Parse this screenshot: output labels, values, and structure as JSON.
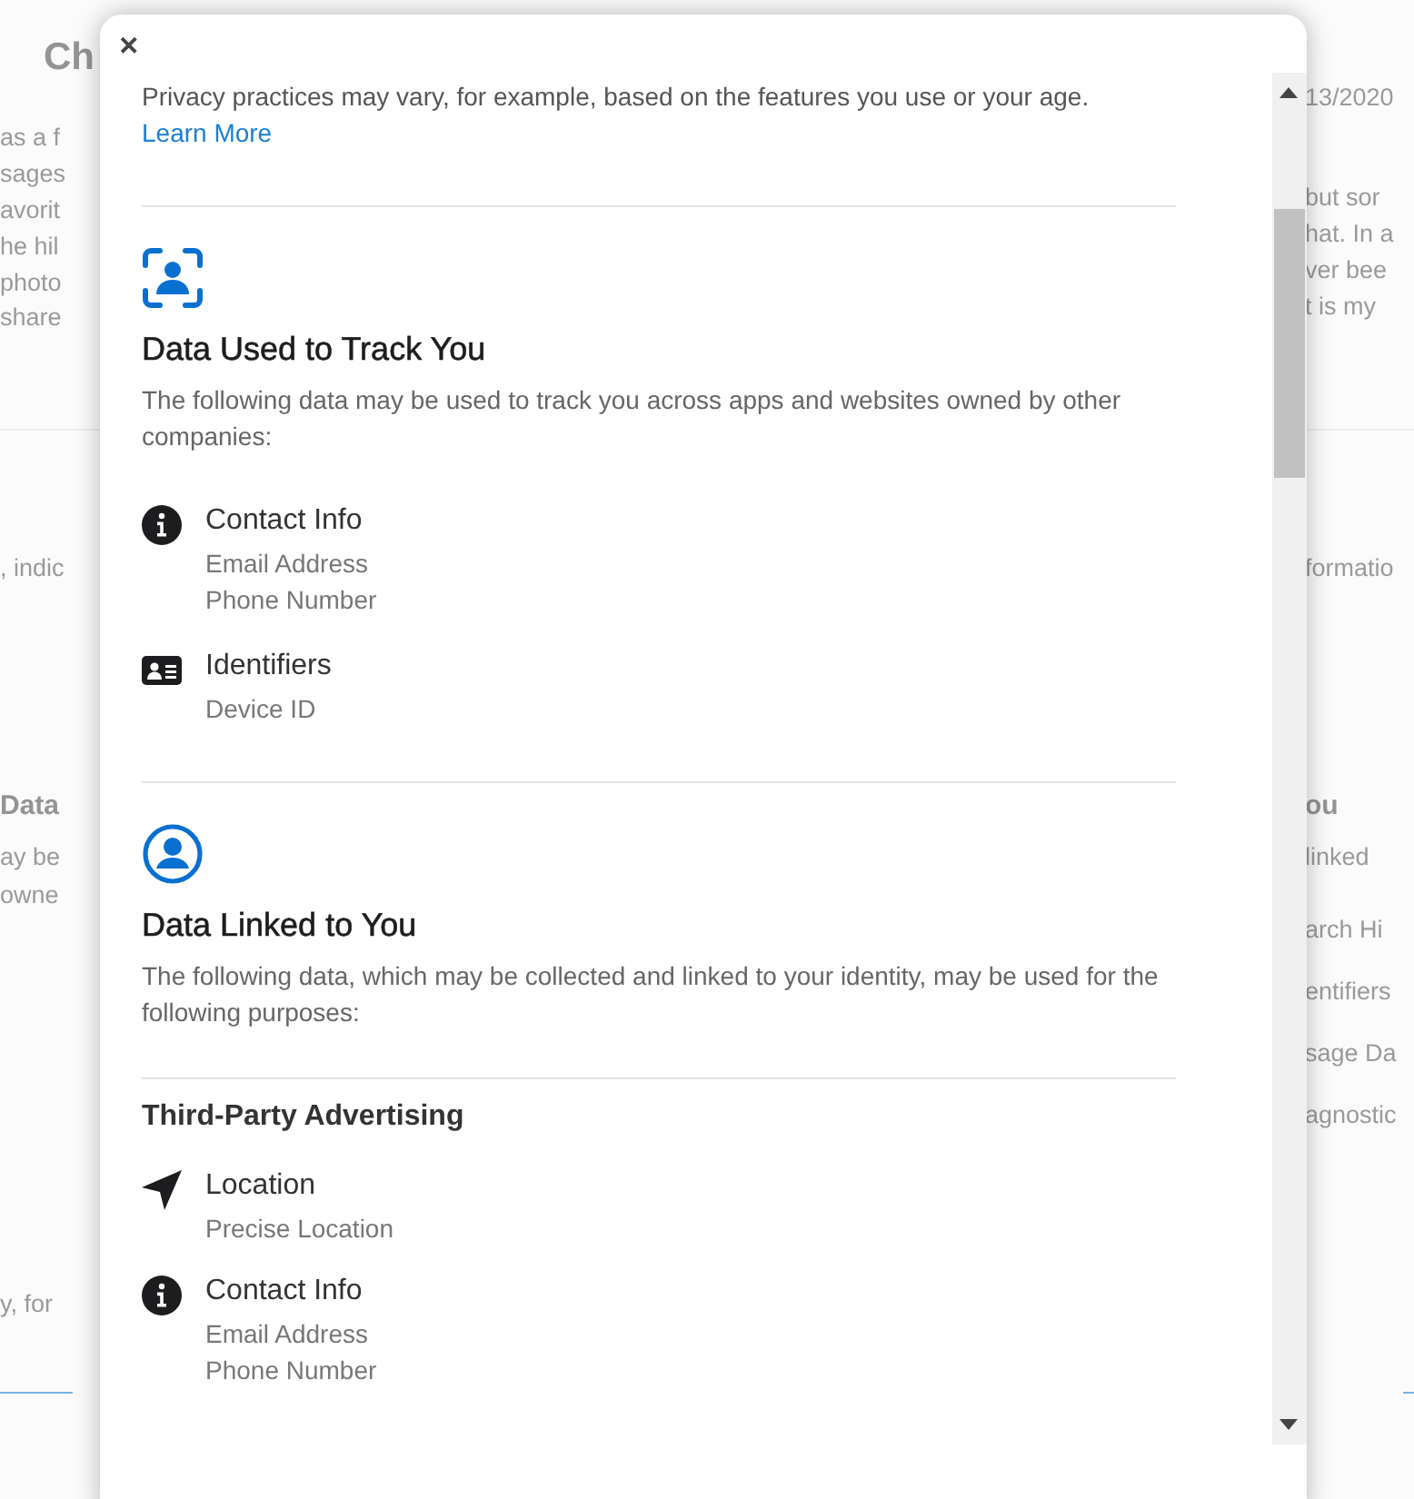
{
  "backdrop": {
    "left_fragments": [
      {
        "text": "Ch",
        "kind": "title"
      },
      {
        "text": "as a f",
        "kind": "text"
      },
      {
        "text": "sages",
        "kind": "text"
      },
      {
        "text": "avorit",
        "kind": "text"
      },
      {
        "text": "he hil",
        "kind": "text"
      },
      {
        "text": "photo",
        "kind": "text"
      },
      {
        "text": "share",
        "kind": "text"
      },
      {
        "text": ", indic",
        "kind": "text"
      },
      {
        "text": "Data",
        "kind": "title"
      },
      {
        "text": "ay be",
        "kind": "text"
      },
      {
        "text": "owne",
        "kind": "text"
      },
      {
        "text": "y, for",
        "kind": "text"
      }
    ],
    "right_fragments": [
      {
        "text": "13/2020",
        "kind": "text"
      },
      {
        "text": "but sor",
        "kind": "text"
      },
      {
        "text": "hat. In a",
        "kind": "text"
      },
      {
        "text": "ver bee",
        "kind": "text"
      },
      {
        "text": "t is my",
        "kind": "text"
      },
      {
        "text": "formatio",
        "kind": "text"
      },
      {
        "text": "ou",
        "kind": "title"
      },
      {
        "text": "linked",
        "kind": "text"
      },
      {
        "text": "arch Hi",
        "kind": "text"
      },
      {
        "text": "entifiers",
        "kind": "text"
      },
      {
        "text": "sage Da",
        "kind": "text"
      },
      {
        "text": "agnostic",
        "kind": "text"
      }
    ]
  },
  "dialog": {
    "close": "✕",
    "intro": "Privacy practices may vary, for example, based on the features you use or your age.",
    "link": "Learn More",
    "sections": [
      {
        "kind": "track",
        "title": "Data Used to Track You",
        "description": "The following data may be used to track you across apps and websites owned by other companies:",
        "groups": [
          {
            "items": [
              {
                "kind": "info",
                "title": "Contact Info",
                "details": [
                  "Email Address",
                  "Phone Number"
                ]
              },
              {
                "kind": "id-card",
                "title": "Identifiers",
                "details": [
                  "Device ID"
                ]
              }
            ]
          }
        ]
      },
      {
        "kind": "linked",
        "title": "Data Linked to You",
        "description": "The following data, which may be collected and linked to your identity, may be used for the following purposes:",
        "groups": [
          {
            "heading": "Third-Party Advertising",
            "items": [
              {
                "kind": "location",
                "title": "Location",
                "details": [
                  "Precise Location"
                ]
              },
              {
                "kind": "info",
                "title": "Contact Info",
                "details": [
                  "Email Address",
                  "Phone Number"
                ]
              }
            ]
          }
        ]
      }
    ]
  }
}
